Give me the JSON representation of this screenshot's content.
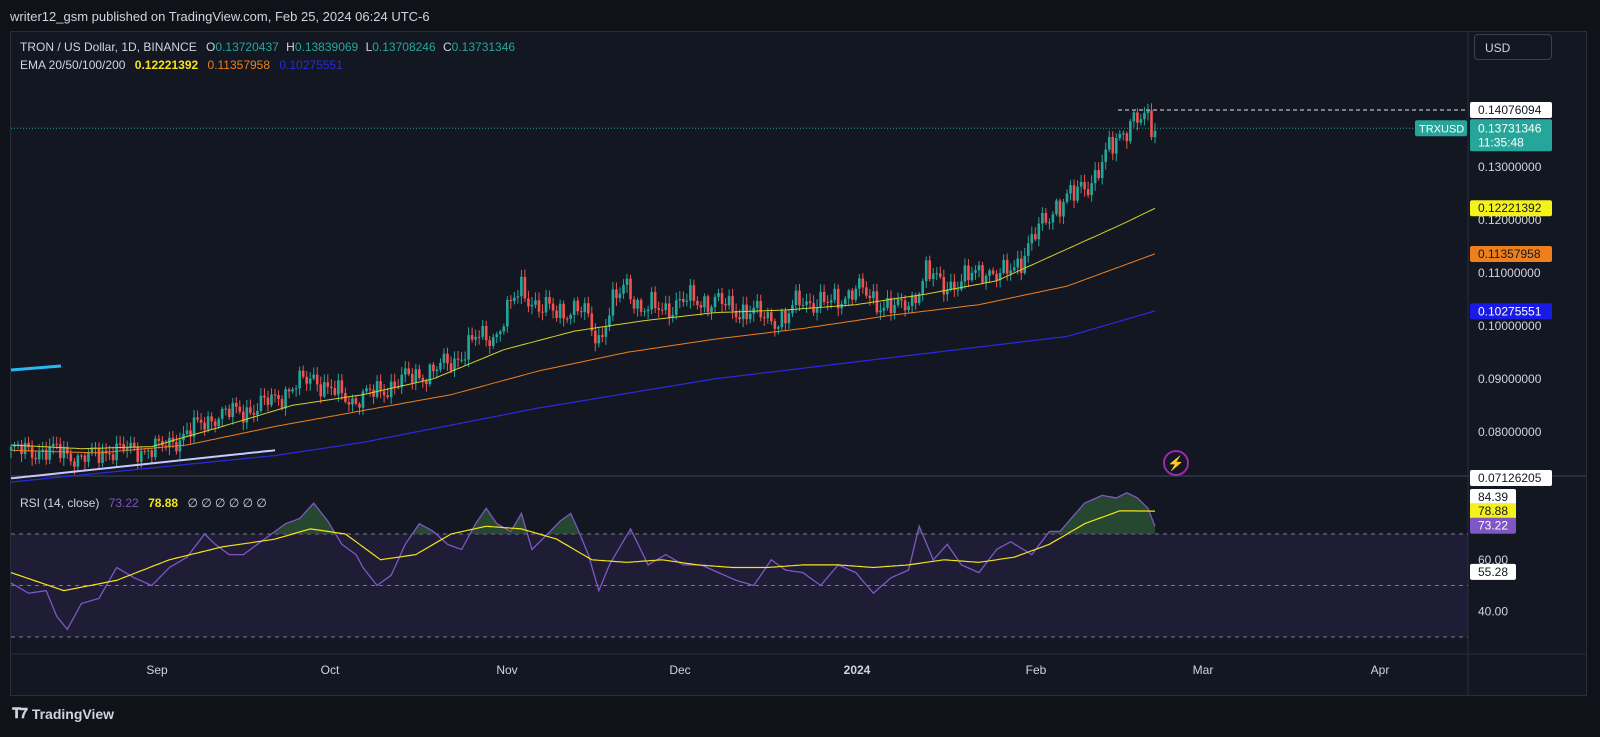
{
  "header": {
    "published": "writer12_gsm published on TradingView.com, Feb 25, 2024 06:24 UTC-6"
  },
  "legend": {
    "symbol": "TRON / US Dollar, 1D, BINANCE",
    "o_label": "O",
    "o": "0.13720437",
    "h_label": "H",
    "h": "0.13839069",
    "l_label": "L",
    "l": "0.13708246",
    "c_label": "C",
    "c": "0.13731346",
    "ema_label": "EMA 20/50/100/200",
    "ema20": "0.12221392",
    "ema50": "0.11357958",
    "ema100": "0.10275551"
  },
  "rsi_legend": {
    "label": "RSI (14, close)",
    "rsi": "73.22",
    "ma": "78.88",
    "extra": "∅ ∅ ∅ ∅ ∅ ∅"
  },
  "currency": "USD",
  "price_scale": {
    "ticks": [
      "0.13000000",
      "0.12000000",
      "0.11000000",
      "0.10000000",
      "0.09000000",
      "0.08000000"
    ],
    "high_tag": "0.14076094",
    "last_symbol": "TRXUSD",
    "last_price": "0.13731346",
    "countdown": "11:35:48",
    "ema20_tag": "0.12221392",
    "ema50_tag": "0.11357958",
    "ema100_tag": "0.10275551",
    "low_tag": "0.07126205"
  },
  "rsi_scale": {
    "ticks": [
      "60.00",
      "40.00"
    ],
    "tag1": "84.39",
    "tag2": "78.88",
    "tag3": "73.22",
    "tag4": "55.28"
  },
  "time_axis": [
    "Sep",
    "Oct",
    "Nov",
    "Dec",
    "2024",
    "Feb",
    "Mar",
    "Apr"
  ],
  "footer": {
    "brand": "TradingView"
  },
  "colors": {
    "up": "#26a69a",
    "down": "#ef5350",
    "ema20": "#d4d12b",
    "ema50": "#ef7f1a",
    "ema100": "#2a2ae0",
    "rsi": "#7e57c2",
    "rsi_ma": "#f5e31b"
  },
  "chart_data": {
    "type": "candlestick",
    "title": "TRON / US Dollar, 1D, BINANCE",
    "x_range": [
      "2023-08-04",
      "2024-04-25"
    ],
    "y_range": [
      0.0712,
      0.1408
    ],
    "x_start": "2023-08-04",
    "price_path": [
      [
        0,
        0.0765
      ],
      [
        15,
        0.0762
      ],
      [
        20,
        0.0748
      ],
      [
        28,
        0.0766
      ],
      [
        35,
        0.0765
      ],
      [
        43,
        0.077
      ],
      [
        48,
        0.079
      ],
      [
        58,
        0.083
      ],
      [
        70,
        0.0845
      ],
      [
        78,
        0.0875
      ],
      [
        86,
        0.0905
      ],
      [
        90,
        0.088
      ],
      [
        97,
        0.086
      ],
      [
        104,
        0.0875
      ],
      [
        112,
        0.09
      ],
      [
        120,
        0.0915
      ],
      [
        126,
        0.0935
      ],
      [
        132,
        0.0975
      ],
      [
        138,
        0.0985
      ],
      [
        145,
        0.1075
      ],
      [
        150,
        0.103
      ],
      [
        157,
        0.103
      ],
      [
        163,
        0.1025
      ],
      [
        167,
        0.0975
      ],
      [
        171,
        0.104
      ],
      [
        175,
        0.108
      ],
      [
        179,
        0.103
      ],
      [
        186,
        0.1035
      ],
      [
        194,
        0.105
      ],
      [
        200,
        0.1045
      ],
      [
        207,
        0.103
      ],
      [
        213,
        0.102
      ],
      [
        220,
        0.101
      ],
      [
        224,
        0.105
      ],
      [
        232,
        0.104
      ],
      [
        240,
        0.107
      ],
      [
        245,
        0.105
      ],
      [
        252,
        0.103
      ],
      [
        256,
        0.105
      ],
      [
        260,
        0.11
      ],
      [
        264,
        0.108
      ],
      [
        270,
        0.108
      ],
      [
        276,
        0.111
      ],
      [
        281,
        0.109
      ],
      [
        286,
        0.112
      ],
      [
        292,
        0.118
      ],
      [
        297,
        0.123
      ],
      [
        302,
        0.1245
      ],
      [
        308,
        0.1285
      ],
      [
        314,
        0.135
      ],
      [
        318,
        0.139
      ],
      [
        322,
        0.1385
      ],
      [
        325,
        0.1373
      ]
    ],
    "ema20_path": [
      [
        0,
        0.0775
      ],
      [
        20,
        0.0768
      ],
      [
        40,
        0.0772
      ],
      [
        60,
        0.081
      ],
      [
        80,
        0.085
      ],
      [
        100,
        0.087
      ],
      [
        120,
        0.09
      ],
      [
        140,
        0.0955
      ],
      [
        160,
        0.099
      ],
      [
        180,
        0.101
      ],
      [
        200,
        0.1025
      ],
      [
        220,
        0.103
      ],
      [
        240,
        0.104
      ],
      [
        260,
        0.106
      ],
      [
        280,
        0.1085
      ],
      [
        300,
        0.1145
      ],
      [
        315,
        0.119
      ],
      [
        325,
        0.1222
      ]
    ],
    "ema50_path": [
      [
        0,
        0.0765
      ],
      [
        25,
        0.076
      ],
      [
        50,
        0.0775
      ],
      [
        75,
        0.081
      ],
      [
        100,
        0.084
      ],
      [
        125,
        0.087
      ],
      [
        150,
        0.0915
      ],
      [
        175,
        0.095
      ],
      [
        200,
        0.0975
      ],
      [
        225,
        0.0995
      ],
      [
        250,
        0.102
      ],
      [
        275,
        0.104
      ],
      [
        300,
        0.1075
      ],
      [
        325,
        0.1136
      ]
    ],
    "ema100_path": [
      [
        0,
        0.0705
      ],
      [
        75,
        0.0755
      ],
      [
        100,
        0.078
      ],
      [
        150,
        0.0845
      ],
      [
        200,
        0.09
      ],
      [
        250,
        0.094
      ],
      [
        300,
        0.098
      ],
      [
        325,
        0.1028
      ]
    ],
    "ema200_path": [
      [
        0,
        0.0712
      ],
      [
        75,
        0.0765
      ]
    ],
    "rsi_path": [
      [
        0,
        51
      ],
      [
        5,
        47
      ],
      [
        10,
        48
      ],
      [
        13,
        38
      ],
      [
        16,
        33
      ],
      [
        20,
        43
      ],
      [
        25,
        45
      ],
      [
        30,
        57
      ],
      [
        35,
        53
      ],
      [
        40,
        50
      ],
      [
        45,
        57
      ],
      [
        50,
        61
      ],
      [
        55,
        70
      ],
      [
        58,
        66
      ],
      [
        62,
        62
      ],
      [
        66,
        62
      ],
      [
        72,
        68
      ],
      [
        78,
        74
      ],
      [
        82,
        76
      ],
      [
        86,
        82
      ],
      [
        90,
        75
      ],
      [
        94,
        66
      ],
      [
        98,
        62
      ],
      [
        100,
        57
      ],
      [
        104,
        50
      ],
      [
        108,
        54
      ],
      [
        112,
        66
      ],
      [
        116,
        74
      ],
      [
        120,
        71
      ],
      [
        124,
        66
      ],
      [
        128,
        64
      ],
      [
        132,
        74
      ],
      [
        135,
        80
      ],
      [
        138,
        74
      ],
      [
        142,
        71
      ],
      [
        145,
        78
      ],
      [
        148,
        64
      ],
      [
        151,
        68
      ],
      [
        156,
        75
      ],
      [
        159,
        78
      ],
      [
        161,
        72
      ],
      [
        164,
        62
      ],
      [
        167,
        48
      ],
      [
        170,
        58
      ],
      [
        176,
        72
      ],
      [
        181,
        58
      ],
      [
        186,
        62
      ],
      [
        191,
        58
      ],
      [
        196,
        58
      ],
      [
        201,
        55
      ],
      [
        206,
        52
      ],
      [
        211,
        50
      ],
      [
        216,
        60
      ],
      [
        220,
        56
      ],
      [
        225,
        55
      ],
      [
        230,
        50
      ],
      [
        235,
        58
      ],
      [
        240,
        55
      ],
      [
        245,
        47
      ],
      [
        250,
        53
      ],
      [
        255,
        56
      ],
      [
        258,
        73
      ],
      [
        262,
        60
      ],
      [
        266,
        66
      ],
      [
        270,
        58
      ],
      [
        275,
        55
      ],
      [
        280,
        64
      ],
      [
        284,
        67
      ],
      [
        290,
        62
      ],
      [
        295,
        71
      ],
      [
        298,
        71
      ],
      [
        305,
        82
      ],
      [
        310,
        85
      ],
      [
        314,
        84
      ],
      [
        317,
        86
      ],
      [
        320,
        84
      ],
      [
        323,
        80
      ],
      [
        325,
        73
      ]
    ],
    "rsi_ma_path": [
      [
        0,
        55
      ],
      [
        15,
        48
      ],
      [
        30,
        52
      ],
      [
        45,
        60
      ],
      [
        60,
        65
      ],
      [
        75,
        68
      ],
      [
        85,
        72
      ],
      [
        95,
        70
      ],
      [
        105,
        60
      ],
      [
        115,
        62
      ],
      [
        125,
        70
      ],
      [
        135,
        73
      ],
      [
        145,
        72
      ],
      [
        155,
        68
      ],
      [
        165,
        60
      ],
      [
        175,
        59
      ],
      [
        185,
        60
      ],
      [
        195,
        58
      ],
      [
        205,
        57
      ],
      [
        215,
        57
      ],
      [
        225,
        58
      ],
      [
        235,
        58
      ],
      [
        245,
        57
      ],
      [
        255,
        58
      ],
      [
        265,
        60
      ],
      [
        275,
        59
      ],
      [
        285,
        61
      ],
      [
        295,
        66
      ],
      [
        305,
        74
      ],
      [
        315,
        79
      ],
      [
        325,
        78.9
      ]
    ],
    "rsi_levels": [
      70,
      50,
      30
    ],
    "rsi_range": [
      28,
      90
    ]
  }
}
